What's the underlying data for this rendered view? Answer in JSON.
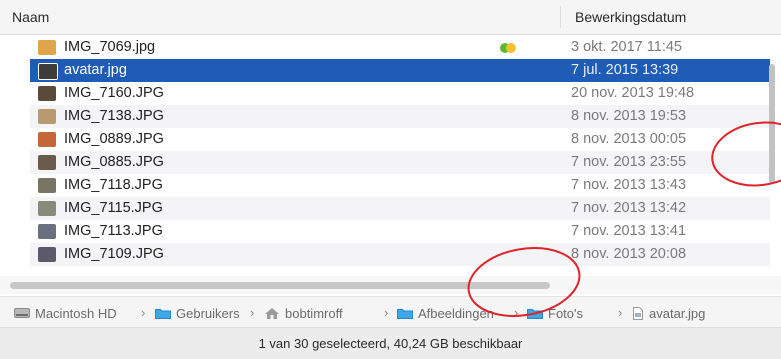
{
  "columns": {
    "name": "Naam",
    "date": "Bewerkingsdatum"
  },
  "files": [
    {
      "name": "IMG_7069.jpg",
      "date": "3 okt. 2017 11:45",
      "thumb": "#e0a54a",
      "tagged": true
    },
    {
      "name": "avatar.jpg",
      "date": "7 jul. 2015 13:39",
      "thumb": "#3d3d3d",
      "selected": true
    },
    {
      "name": "IMG_7160.JPG",
      "date": "20 nov. 2013 19:48",
      "thumb": "#5a4a3a"
    },
    {
      "name": "IMG_7138.JPG",
      "date": "8 nov. 2013 19:53",
      "thumb": "#b89a70"
    },
    {
      "name": "IMG_0889.JPG",
      "date": "8 nov. 2013 00:05",
      "thumb": "#c4663a"
    },
    {
      "name": "IMG_0885.JPG",
      "date": "7 nov. 2013 23:55",
      "thumb": "#6a5a4a"
    },
    {
      "name": "IMG_7118.JPG",
      "date": "7 nov. 2013 13:43",
      "thumb": "#7a7464"
    },
    {
      "name": "IMG_7115.JPG",
      "date": "7 nov. 2013 13:42",
      "thumb": "#8a8a7a"
    },
    {
      "name": "IMG_7113.JPG",
      "date": "7 nov. 2013 13:41",
      "thumb": "#6a7080"
    },
    {
      "name": "IMG_7109.JPG",
      "date": "8 nov. 2013 20:08",
      "thumb": "#5a5a6a"
    }
  ],
  "path": [
    {
      "label": "Macintosh HD",
      "icon": "hard-drive-icon"
    },
    {
      "label": "Gebruikers",
      "icon": "folder-icon"
    },
    {
      "label": "bobtimroff",
      "icon": "home-icon"
    },
    {
      "label": "Afbeeldingen",
      "icon": "folder-icon"
    },
    {
      "label": "Foto's",
      "icon": "folder-icon"
    },
    {
      "label": "avatar.jpg",
      "icon": "file-icon"
    }
  ],
  "status": "1 van 30 geselecteerd, 40,24 GB beschikbaar",
  "colors": {
    "selection": "#1f5cb5",
    "tag_green": "#5cb833",
    "tag_yellow": "#f2c230",
    "folder_blue": "#3fa7e8",
    "annotation_red": "#e0242a"
  }
}
